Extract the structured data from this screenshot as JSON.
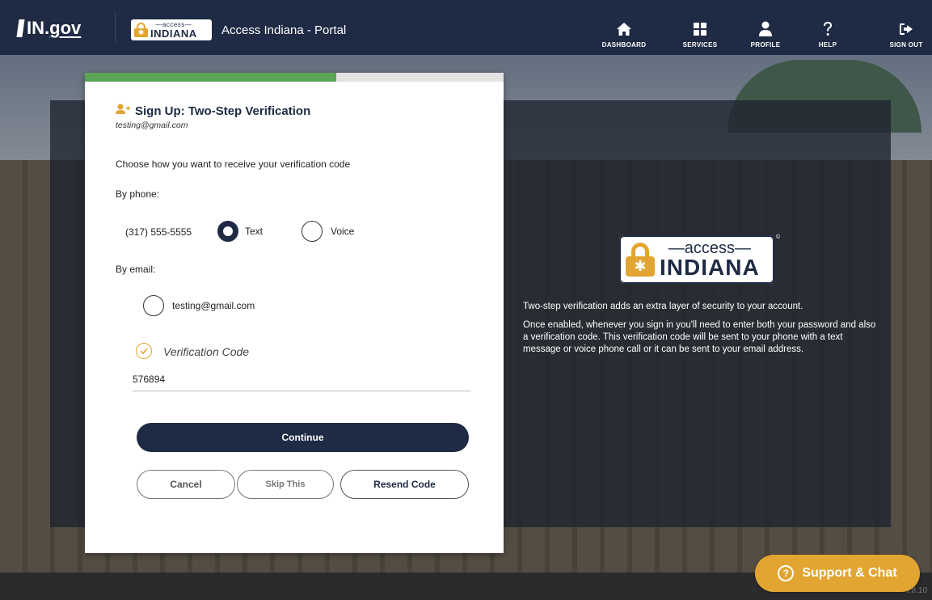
{
  "header": {
    "ingov_logo": "IN.gov",
    "ingov_prefix": "IN.",
    "ingov_suffix": "gov",
    "brand_access": "—access—",
    "brand_indiana": "INDIANA",
    "portal_title": "Access Indiana - Portal",
    "nav": [
      {
        "label": "DASHBOARD",
        "icon": "home-icon"
      },
      {
        "label": "SERVICES",
        "icon": "grid-icon"
      },
      {
        "label": "PROFILE",
        "icon": "user-icon"
      },
      {
        "label": "HELP",
        "icon": "question-icon"
      },
      {
        "label": "SIGN OUT",
        "icon": "sign-out-icon"
      }
    ]
  },
  "card": {
    "progress_fraction": 0.6,
    "title": "Sign Up: Two-Step Verification",
    "email": "testing@gmail.com",
    "instruction": "Choose how you want to receive your verification code",
    "by_phone_label": "By phone:",
    "phone_number": "(317) 555-5555",
    "phone_options": [
      {
        "label": "Text",
        "selected": true
      },
      {
        "label": "Voice",
        "selected": false
      }
    ],
    "by_email_label": "By email:",
    "email_option": {
      "label": "testing@gmail.com",
      "selected": false
    },
    "code_label": "Verification Code",
    "code_value": "576894",
    "continue_label": "Continue",
    "cancel_label": "Cancel",
    "skip_label": "Skip This",
    "resend_label": "Resend Code"
  },
  "info": {
    "logo_access": "—access—",
    "logo_indiana": "INDIANA",
    "copyright": "©",
    "paragraph1": "Two-step verification adds an extra layer of security to your account.",
    "paragraph2": "Once enabled, whenever you sign in you'll need to enter both your password and also a verification code. This verification code will be sent to your phone with a text message or voice phone call or it can be sent to your email address."
  },
  "support": {
    "label": "Support & Chat",
    "icon_glyph": "?"
  },
  "version": "v.8.10",
  "colors": {
    "navy": "#1f2a44",
    "gold": "#e2a531",
    "progress_green": "#5da556"
  }
}
